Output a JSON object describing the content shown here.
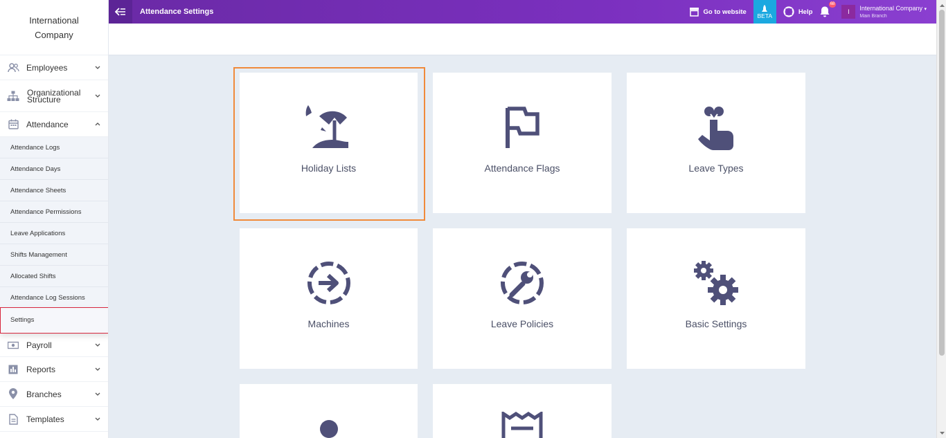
{
  "sidebar": {
    "company": "International Company",
    "items": [
      {
        "label": "Employees",
        "icon": "users-icon"
      },
      {
        "label": "Organizational Structure",
        "icon": "org-structure-icon"
      },
      {
        "label": "Attendance",
        "icon": "calendar-icon"
      }
    ],
    "attendance_sub": [
      "Attendance Logs",
      "Attendance Days",
      "Attendance Sheets",
      "Attendance Permissions",
      "Leave Applications",
      "Shifts Management",
      "Allocated Shifts",
      "Attendance Log Sessions",
      "Settings"
    ],
    "bottom_items": [
      {
        "label": "Payroll",
        "icon": "money-icon"
      },
      {
        "label": "Reports",
        "icon": "bar-chart-icon"
      },
      {
        "label": "Branches",
        "icon": "map-pin-icon"
      },
      {
        "label": "Templates",
        "icon": "document-icon"
      }
    ]
  },
  "topbar": {
    "title": "Attendance Settings",
    "go_to_website": "Go to website",
    "beta": "BETA",
    "help": "Help",
    "notifications_count": "68",
    "account_initial": "I",
    "account_name": "International Company",
    "account_branch": "Main Branch"
  },
  "cards": [
    {
      "label": "Holiday Lists",
      "icon": "beach-umbrella-icon",
      "selected": true
    },
    {
      "label": "Attendance Flags",
      "icon": "flag-icon"
    },
    {
      "label": "Leave Types",
      "icon": "hand-ribbon-icon"
    },
    {
      "label": "Machines",
      "icon": "circle-arrow-icon"
    },
    {
      "label": "Leave Policies",
      "icon": "circle-wrench-icon"
    },
    {
      "label": "Basic Settings",
      "icon": "gears-icon"
    },
    {
      "label": "",
      "icon": "person-icon"
    },
    {
      "label": "",
      "icon": "receipt-icon"
    }
  ],
  "colors": {
    "accent_purple": "#7b30bf",
    "beta_blue": "#1ba8e0",
    "icon": "#4f5079",
    "selected_outline": "#f08a3a",
    "active_sidebar_outline": "#d7263d"
  }
}
